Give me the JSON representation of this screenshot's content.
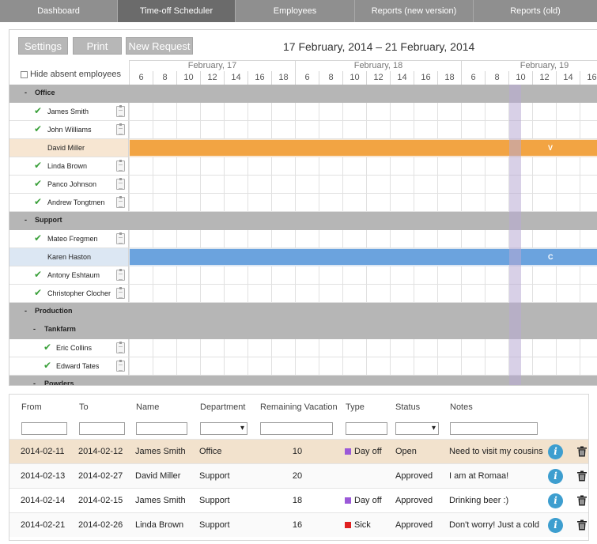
{
  "nav": {
    "tabs": [
      {
        "label": "Dashboard",
        "active": false
      },
      {
        "label": "Time-off Scheduler",
        "active": true
      },
      {
        "label": "Employees",
        "active": false
      },
      {
        "label": "Reports (new version)",
        "active": false
      },
      {
        "label": "Reports (old)",
        "active": false
      }
    ]
  },
  "scheduler": {
    "buttons": {
      "settings": "Settings",
      "print": "Print",
      "new_request": "New Request"
    },
    "date_range": "17 February, 2014 – 21 February, 2014",
    "hide_absent_label": "Hide absent employees",
    "days": [
      "February, 17",
      "February, 18",
      "February, 19"
    ],
    "hours": [
      "6",
      "8",
      "10",
      "12",
      "14",
      "16",
      "18",
      "6",
      "8",
      "10",
      "12",
      "14",
      "16",
      "18",
      "6",
      "8",
      "10",
      "12",
      "14",
      "16"
    ],
    "groups": {
      "office": {
        "toggle": "-",
        "name": "Office"
      },
      "support": {
        "toggle": "-",
        "name": "Support"
      },
      "production": {
        "toggle": "-",
        "name": "Production"
      },
      "tankfarm": {
        "toggle": "-",
        "name": "Tankfarm"
      },
      "powders": {
        "toggle": "-",
        "name": "Powders"
      }
    },
    "employees": {
      "james": "James Smith",
      "john": "John Williams",
      "david": "David Miller",
      "linda": "Linda Brown",
      "panco": "Panco Johnson",
      "andrew": "Andrew Tongtmen",
      "mateo": "Mateo Fregmen",
      "karen": "Karen Haston",
      "antony": "Antony Eshtaum",
      "christopher": "Christopher Clocher",
      "eric": "Eric Collins",
      "edward": "Edward Tates"
    },
    "bars": {
      "david": {
        "code": "V",
        "color": "#f2a443",
        "row_color": "#f7e6d2"
      },
      "karen": {
        "code": "C",
        "color": "#6ba3de",
        "row_color": "#dce7f3"
      }
    },
    "highlight_color": "#b8a9d4"
  },
  "requests": {
    "headers": [
      "From",
      "To",
      "Name",
      "Department",
      "Remaining Vacation",
      "Type",
      "Status",
      "Notes"
    ],
    "rows": [
      {
        "from": "2014-02-11",
        "to": "2014-02-12",
        "name": "James Smith",
        "department": "Office",
        "remaining": "10",
        "type": "Day off",
        "type_color": "#9b59d8",
        "status": "Open",
        "notes": "Need to visit my cousins",
        "highlight": true
      },
      {
        "from": "2014-02-13",
        "to": "2014-02-27",
        "name": "David Miller",
        "department": "Support",
        "remaining": "20",
        "type": "",
        "type_color": "",
        "status": "Approved",
        "notes": "I am at Romaa!",
        "highlight": false
      },
      {
        "from": "2014-02-14",
        "to": "2014-02-15",
        "name": "James Smith",
        "department": "Support",
        "remaining": "18",
        "type": "Day off",
        "type_color": "#9b59d8",
        "status": "Approved",
        "notes": "Drinking beer :)",
        "highlight": false
      },
      {
        "from": "2014-02-21",
        "to": "2014-02-26",
        "name": "Linda Brown",
        "department": "Support",
        "remaining": "16",
        "type": "Sick",
        "type_color": "#e02020",
        "status": "Approved",
        "notes": "Don't worry! Just a cold",
        "highlight": false
      }
    ]
  }
}
